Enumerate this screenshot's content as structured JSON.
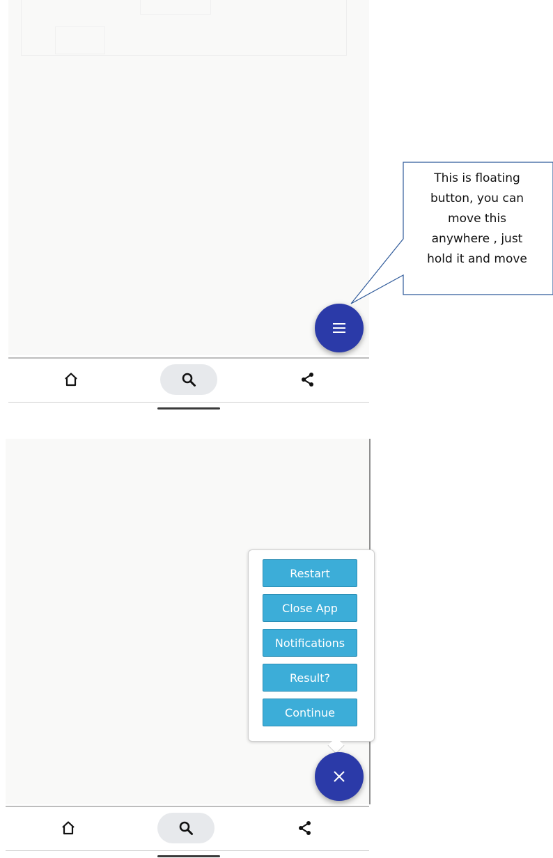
{
  "callout": {
    "lines": [
      "This is floating",
      "button, you can",
      "move this",
      "anywhere , just",
      "hold it and move"
    ]
  },
  "screen1": {
    "fab_icon": "menu-icon"
  },
  "screen2": {
    "fab_icon": "close-icon",
    "menu": {
      "restart": "Restart",
      "close_app": "Close App",
      "notifications": "Notifications",
      "result": "Result?",
      "continue": "Continue"
    }
  },
  "bottom_nav": {
    "icons": [
      "home-icon",
      "search-icon",
      "share-icon"
    ]
  },
  "colors": {
    "fab": "#2b3aa8",
    "menu_button": "#3cadd8",
    "search_pill": "#e7e9ec"
  }
}
